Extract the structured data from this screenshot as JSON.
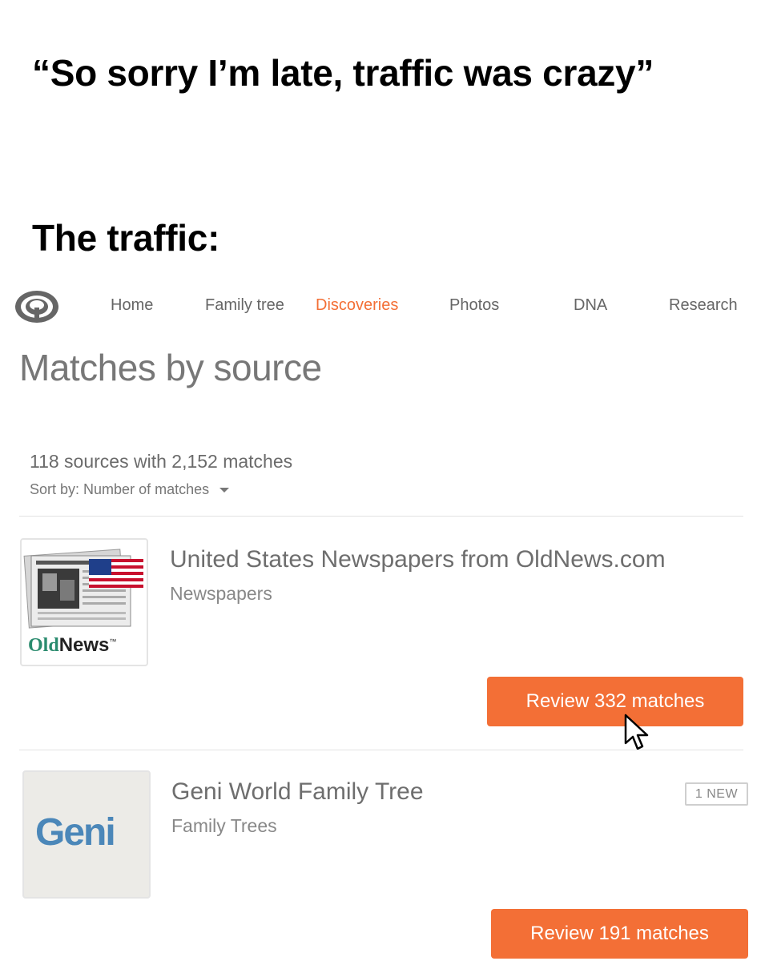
{
  "caption": {
    "top": "“So sorry I’m late, traffic was crazy”",
    "bottom": "The traffic:"
  },
  "nav": {
    "items": [
      {
        "label": "Home",
        "active": false
      },
      {
        "label": "Family tree",
        "active": false
      },
      {
        "label": "Discoveries",
        "active": true
      },
      {
        "label": "Photos",
        "active": false
      },
      {
        "label": "DNA",
        "active": false
      },
      {
        "label": "Research",
        "active": false
      }
    ]
  },
  "page": {
    "title": "Matches by source",
    "summary": "118 sources with 2,152 matches",
    "sort_label": "Sort by:",
    "sort_value": "Number of matches"
  },
  "sources": [
    {
      "name": "United States Newspapers from OldNews.com",
      "type": "Newspapers",
      "logo_text_old": "Old",
      "logo_text_news": "News",
      "logo_tm": "™",
      "button_label": "Review 332 matches",
      "badge": ""
    },
    {
      "name": "Geni World Family Tree",
      "type": "Family Trees",
      "logo_text": "Geni",
      "button_label": "Review 191 matches",
      "badge": "1 NEW"
    }
  ],
  "colors": {
    "accent": "#f36f36",
    "nav_text": "#666666",
    "title_text": "#777777",
    "geni_blue": "#4b87b9",
    "oldnews_green": "#2a8b6e"
  },
  "icons": [
    "site-logo-icon",
    "dropdown-caret-icon",
    "mouse-pointer-icon",
    "us-flag-icon"
  ]
}
